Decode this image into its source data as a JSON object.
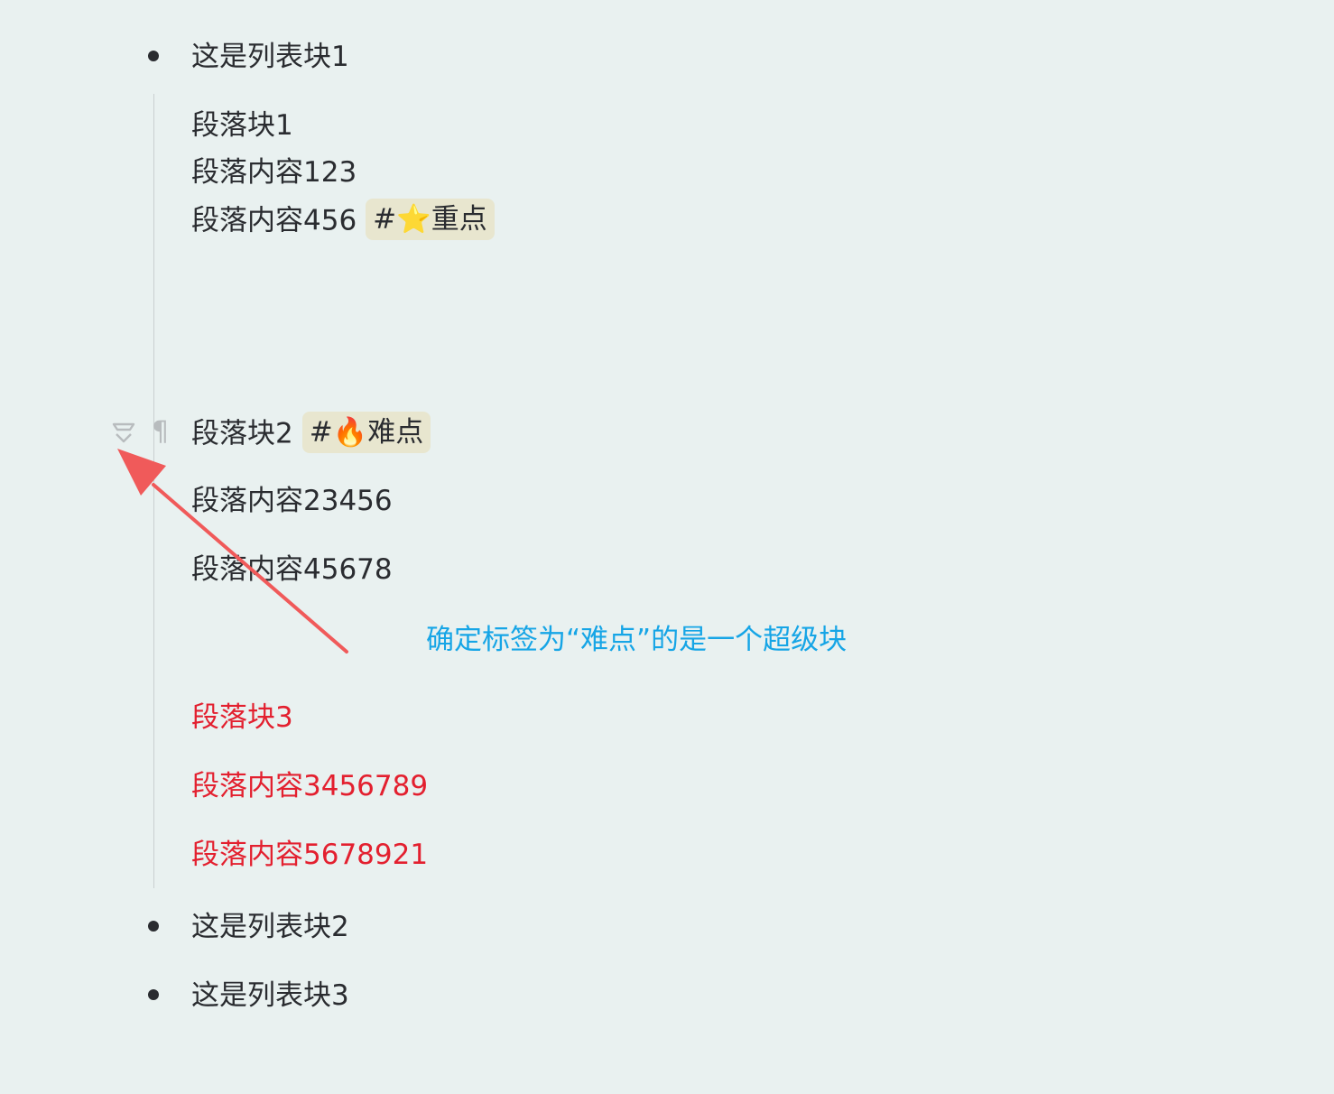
{
  "list": {
    "item1": "这是列表块1",
    "item2": "这是列表块2",
    "item3": "这是列表块3"
  },
  "block1": {
    "line1": "段落块1",
    "line2": "段落内容123",
    "line3": "段落内容456",
    "tag": "#⭐重点"
  },
  "block2": {
    "line1": "段落块2",
    "tag": "#🔥难点",
    "line2": "段落内容23456",
    "line3": "段落内容45678"
  },
  "block3": {
    "line1": "段落块3",
    "line2": "段落内容3456789",
    "line3": "段落内容5678921",
    "color": "#e3202f"
  },
  "annotation": {
    "text": "确定标签为“难点”的是一个超级块",
    "color": "#16a5e6",
    "arrow_color": "#f05a5a"
  },
  "gutter": {
    "icons": [
      "superblock-icon",
      "paragraph-icon"
    ]
  }
}
